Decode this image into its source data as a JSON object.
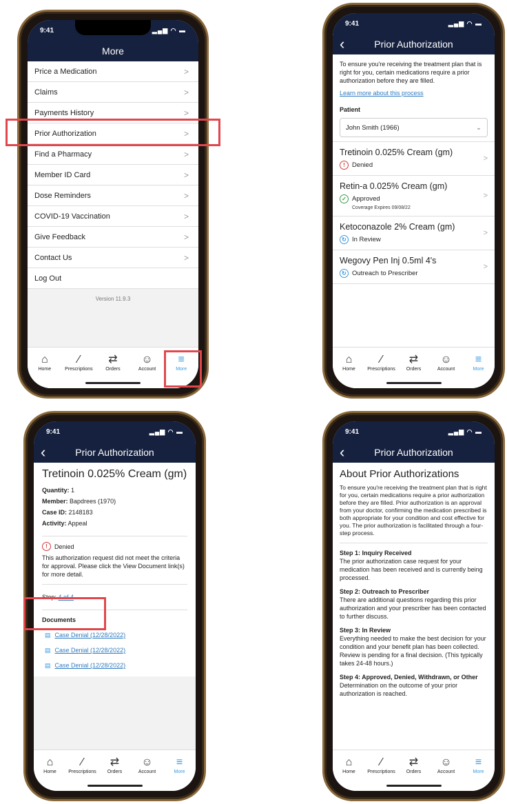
{
  "status_time": "9:41",
  "signal": "▂▄▆ ◠ ▬",
  "tabs": [
    {
      "label": "Home",
      "icon": "⌂"
    },
    {
      "label": "Prescriptions",
      "icon": "∕"
    },
    {
      "label": "Orders",
      "icon": "⇄"
    },
    {
      "label": "Account",
      "icon": "☺"
    },
    {
      "label": "More",
      "icon": "≡"
    }
  ],
  "screen1": {
    "title": "More",
    "items": [
      "Price a Medication",
      "Claims",
      "Payments History",
      "Prior Authorization",
      "Find a Pharmacy",
      "Member ID Card",
      "Dose Reminders",
      "COVID-19 Vaccination",
      "Give Feedback",
      "Contact Us",
      "Log Out"
    ],
    "version": "Version 11.9.3"
  },
  "screen2": {
    "title": "Prior Authorization",
    "intro": "To ensure you're receiving the treatment plan that is right for you, certain medications require a prior authorization before they are filled.",
    "learn_more": "Learn more about this process",
    "patient_label": "Patient",
    "patient_value": "John Smith (1966)",
    "drugs": [
      {
        "name": "Tretinoin 0.025% Cream (gm)",
        "status": "Denied",
        "sub": "",
        "color": "#d33a3a",
        "icon": "!"
      },
      {
        "name": "Retin-a 0.025% Cream (gm)",
        "status": "Approved",
        "sub": "Coverage Expires 09/08/22",
        "color": "#3a9a4a",
        "icon": "✓"
      },
      {
        "name": "Ketoconazole 2% Cream (gm)",
        "status": "In Review",
        "sub": "",
        "color": "#3a9ae0",
        "icon": "↻"
      },
      {
        "name": "Wegovy Pen Inj 0.5ml 4's",
        "status": "Outreach to Prescriber",
        "sub": "",
        "color": "#3a9ae0",
        "icon": "↻"
      }
    ]
  },
  "screen3": {
    "title": "Prior Authorization",
    "drug": "Tretinoin 0.025% Cream (gm)",
    "fields": [
      {
        "label": "Quantity:",
        "value": "1"
      },
      {
        "label": "Member:",
        "value": "Bapdrees (1970)"
      },
      {
        "label": "Case ID:",
        "value": "2148183"
      },
      {
        "label": "Activity:",
        "value": "Appeal"
      }
    ],
    "status": "Denied",
    "status_msg": "This authorization request did not meet the criteria for approval. Please click the View Document link(s) for more detail.",
    "step_label": "Step:",
    "step_value": "4 of 4",
    "docs_label": "Documents",
    "docs": [
      "Case Denial (12/28/2022)",
      "Case Denial (12/28/2022)",
      "Case Denial (12/28/2022)"
    ]
  },
  "screen4": {
    "title": "Prior Authorization",
    "heading": "About Prior Authorizations",
    "intro": "To ensure you're receiving the treatment plan that is right for you, certain medications require a prior authorization before they are filled. Prior authorization is an approval from your doctor, confirming the medication prescribed is both appropriate for your condition and cost effective for you. The prior authorization is facilitated through a four-step process.",
    "steps": [
      {
        "title": "Step 1: Inquiry Received",
        "text": "The prior authorization case request for your medication has been received and is currently being processed."
      },
      {
        "title": "Step 2: Outreach to Prescriber",
        "text": "There are additional questions regarding this prior authorization and your prescriber has been contacted to further discuss."
      },
      {
        "title": "Step 3: In Review",
        "text": "Everything needed to make the best decision for your condition and your benefit plan has been collected. Review is pending for a final decision. (This typically takes 24-48 hours.)"
      },
      {
        "title": "Step 4: Approved, Denied, Withdrawn, or Other",
        "text": "Determination on the outcome of your prior authorization is reached."
      }
    ]
  }
}
